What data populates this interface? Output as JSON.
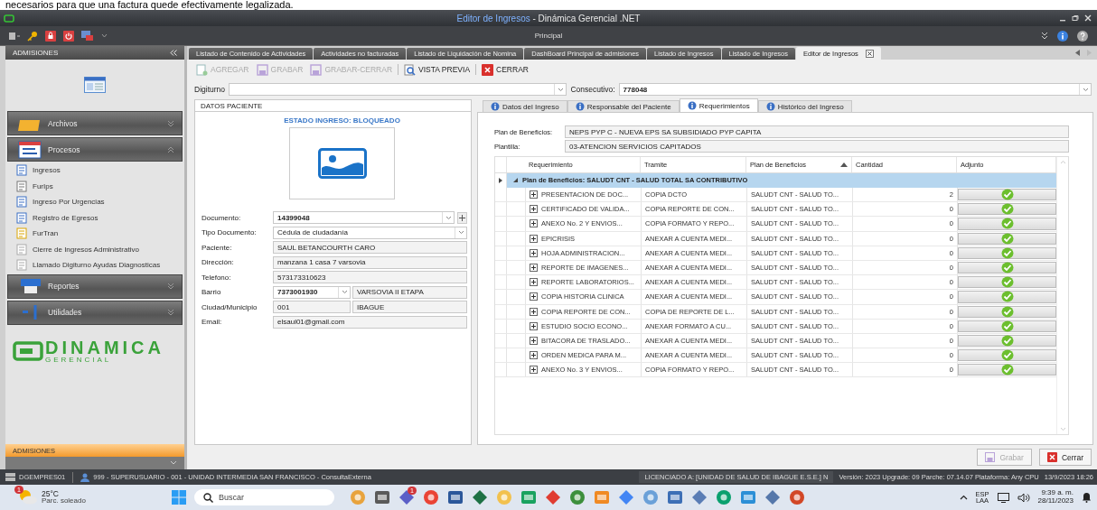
{
  "caption": "necesarios para que una factura quede efectivamente legalizada.",
  "window": {
    "title_document": "Editor de Ingresos",
    "title_app": "- Dinámica Gerencial .NET"
  },
  "ribbon": {
    "title": "Principal"
  },
  "sidebar": {
    "header": "ADMISIONES",
    "groups": [
      {
        "label": "Archivos",
        "expanded": false
      },
      {
        "label": "Procesos",
        "expanded": true,
        "items": [
          {
            "label": "Ingresos"
          },
          {
            "label": "FurIps"
          },
          {
            "label": "Ingreso Por Urgencias"
          },
          {
            "label": "Registro de Egresos"
          },
          {
            "label": "FurTran"
          },
          {
            "label": "Cierre de Ingresos Administrativo"
          },
          {
            "label": "Llamado Digiturno Ayudas Diagnosticas"
          }
        ]
      },
      {
        "label": "Reportes",
        "expanded": false
      },
      {
        "label": "Utilidades",
        "expanded": false
      }
    ],
    "logo": {
      "name": "DINAMICA",
      "sub": "GERENCIAL"
    },
    "footer": "ADMISIONES"
  },
  "tabs": [
    {
      "label": "Listado de Contenido de Actividades",
      "selected": false
    },
    {
      "label": "Actividades no facturadas",
      "selected": false
    },
    {
      "label": "Listado de Liquidación de Nomina",
      "selected": false
    },
    {
      "label": "DashBoard Principal de admisiones",
      "selected": false
    },
    {
      "label": "Listado de Ingresos",
      "selected": false
    },
    {
      "label": "Listado de Ingresos",
      "selected": false
    },
    {
      "label": "Editor de Ingresos",
      "selected": true
    }
  ],
  "toolbar": [
    {
      "kind": "add",
      "label": "AGREGAR",
      "disabled": true
    },
    {
      "kind": "save",
      "label": "GRABAR",
      "disabled": true
    },
    {
      "kind": "save-close",
      "label": "GRABAR-CERRAR",
      "disabled": true
    },
    {
      "kind": "preview",
      "label": "VISTA PREVIA",
      "disabled": false
    },
    {
      "kind": "close",
      "label": "CERRAR",
      "disabled": false
    }
  ],
  "digiturno": {
    "label": "Digiturno",
    "consecutivo_label": "Consecutivo:",
    "consecutivo": "778048"
  },
  "patient": {
    "title": "DATOS PACIENTE",
    "status": "ESTADO INGRESO: BLOQUEADO",
    "fields": [
      {
        "kind": "combo-add",
        "label": "Documento:",
        "value": "14399048"
      },
      {
        "kind": "select",
        "label": "Tipo Documento:",
        "value": "Cédula de ciudadanía"
      },
      {
        "kind": "text",
        "label": "Paciente:",
        "value": "SAUL BETANCOURTH CARO"
      },
      {
        "kind": "text",
        "label": "Dirección:",
        "value": "manzana 1 casa 7 varsovia"
      },
      {
        "kind": "text",
        "label": "Telefono:",
        "value": "573173310623"
      },
      {
        "kind": "pair-select",
        "label": "Barrio",
        "value": "7373001930",
        "value2": "VARSOVIA II ETAPA"
      },
      {
        "kind": "pair",
        "label": "Ciudad/Municipio",
        "value": "001",
        "value2": "IBAGUE"
      },
      {
        "kind": "text",
        "label": "Email:",
        "value": "elsaul01@gmail.com"
      }
    ]
  },
  "detail_tabs": [
    {
      "label": "Datos del Ingreso",
      "selected": false
    },
    {
      "label": "Responsable del Paciente",
      "selected": false
    },
    {
      "label": "Requerimientos",
      "selected": true
    },
    {
      "label": "Histórico del Ingreso",
      "selected": false
    }
  ],
  "plan": {
    "label": "Plan de Beneficios:",
    "value": "NEPS PYP C - NUEVA EPS SA SUBSIDIADO PYP CAPITA",
    "template_label": "Plantilla:",
    "template": "03-ATENCION SERVICIOS CAPITADOS"
  },
  "table": {
    "columns": [
      {
        "label": "Requerimiento",
        "sorted": false
      },
      {
        "label": "Tramite",
        "sorted": false
      },
      {
        "label": "Plan de Beneficios",
        "sorted": true
      },
      {
        "label": "Cantidad",
        "sorted": false
      },
      {
        "label": "Adjunto",
        "sorted": false
      }
    ],
    "group": {
      "label": "Plan de Beneficios: SALUDT CNT - SALUD TOTAL SA CONTRIBUTIVO",
      "expanded": true
    },
    "rows": [
      {
        "requerimiento": "PRESENTACION DE DOC...",
        "tramite": "COPIA DCTO",
        "plan": "SALUDT CNT - SALUD TO...",
        "cantidad": "2",
        "expanded": false
      },
      {
        "requerimiento": "CERTIFICADO DE VALIDA...",
        "tramite": "COPIA REPORTE DE CON...",
        "plan": "SALUDT CNT - SALUD TO...",
        "cantidad": "0",
        "expanded": false
      },
      {
        "requerimiento": "ANEXO No. 2 Y ENVIOS...",
        "tramite": "COPIA FORMATO Y REPO...",
        "plan": "SALUDT CNT - SALUD TO...",
        "cantidad": "0",
        "expanded": false
      },
      {
        "requerimiento": "EPICRISIS",
        "tramite": "ANEXAR A CUENTA MEDI...",
        "plan": "SALUDT CNT - SALUD TO...",
        "cantidad": "0",
        "expanded": false
      },
      {
        "requerimiento": "HOJA ADMINISTRACION...",
        "tramite": "ANEXAR A CUENTA MEDI...",
        "plan": "SALUDT CNT - SALUD TO...",
        "cantidad": "0",
        "expanded": false
      },
      {
        "requerimiento": "REPORTE DE IMAGENES...",
        "tramite": "ANEXAR A CUENTA MEDI...",
        "plan": "SALUDT CNT - SALUD TO...",
        "cantidad": "0",
        "expanded": false
      },
      {
        "requerimiento": "REPORTE LABORATORIOS...",
        "tramite": "ANEXAR A CUENTA MEDI...",
        "plan": "SALUDT CNT - SALUD TO...",
        "cantidad": "0",
        "expanded": false
      },
      {
        "requerimiento": "COPIA HISTORIA CLINICA",
        "tramite": "ANEXAR A CUENTA MEDI...",
        "plan": "SALUDT CNT - SALUD TO...",
        "cantidad": "0",
        "expanded": false
      },
      {
        "requerimiento": "COPIA REPORTE DE CON...",
        "tramite": "COPIA DE REPORTE DE L...",
        "plan": "SALUDT CNT - SALUD TO...",
        "cantidad": "0",
        "expanded": false
      },
      {
        "requerimiento": "ESTUDIO SOCIO ECONO...",
        "tramite": "ANEXAR FORMATO A CU...",
        "plan": "SALUDT CNT - SALUD TO...",
        "cantidad": "0",
        "expanded": false
      },
      {
        "requerimiento": "BITACORA DE TRASLADO...",
        "tramite": "ANEXAR A CUENTA MEDI...",
        "plan": "SALUDT CNT - SALUD TO...",
        "cantidad": "0",
        "expanded": false
      },
      {
        "requerimiento": "ORDEN MEDICA PARA M...",
        "tramite": "ANEXAR A CUENTA MEDI...",
        "plan": "SALUDT CNT - SALUD TO...",
        "cantidad": "0",
        "expanded": false
      },
      {
        "requerimiento": "ANEXO No. 3 Y ENVIOS...",
        "tramite": "COPIA FORMATO Y REPO...",
        "plan": "SALUDT CNT - SALUD TO...",
        "cantidad": "0",
        "expanded": false
      }
    ]
  },
  "footer_buttons": [
    {
      "kind": "save",
      "label": "Grabar",
      "disabled": true
    },
    {
      "kind": "close",
      "label": "Cerrar",
      "disabled": false
    }
  ],
  "status_bar": {
    "server": "DGEMPRES01",
    "user": "999 - SUPERUSUARIO - 001 - UNIDAD INTERMEDIA SAN FRANCISCO - ConsultaExterna",
    "license": "LICENCIADO A: [UNIDAD DE SALUD DE IBAGUE E.S.E.] N",
    "version": "Versión: 2023 Upgrade: 09 Parche: 07.14.07 Plataforma: Any CPU",
    "date": "13/9/2023 18:26"
  },
  "taskbar": {
    "weather_badge": "1",
    "temperature": "25°C",
    "weather": "Parc. soleado",
    "search_placeholder": "Buscar",
    "teams_badge": "1",
    "language": "ESP",
    "layout": "LAA",
    "time": "9:39 a. m.",
    "date": "28/11/2023"
  }
}
